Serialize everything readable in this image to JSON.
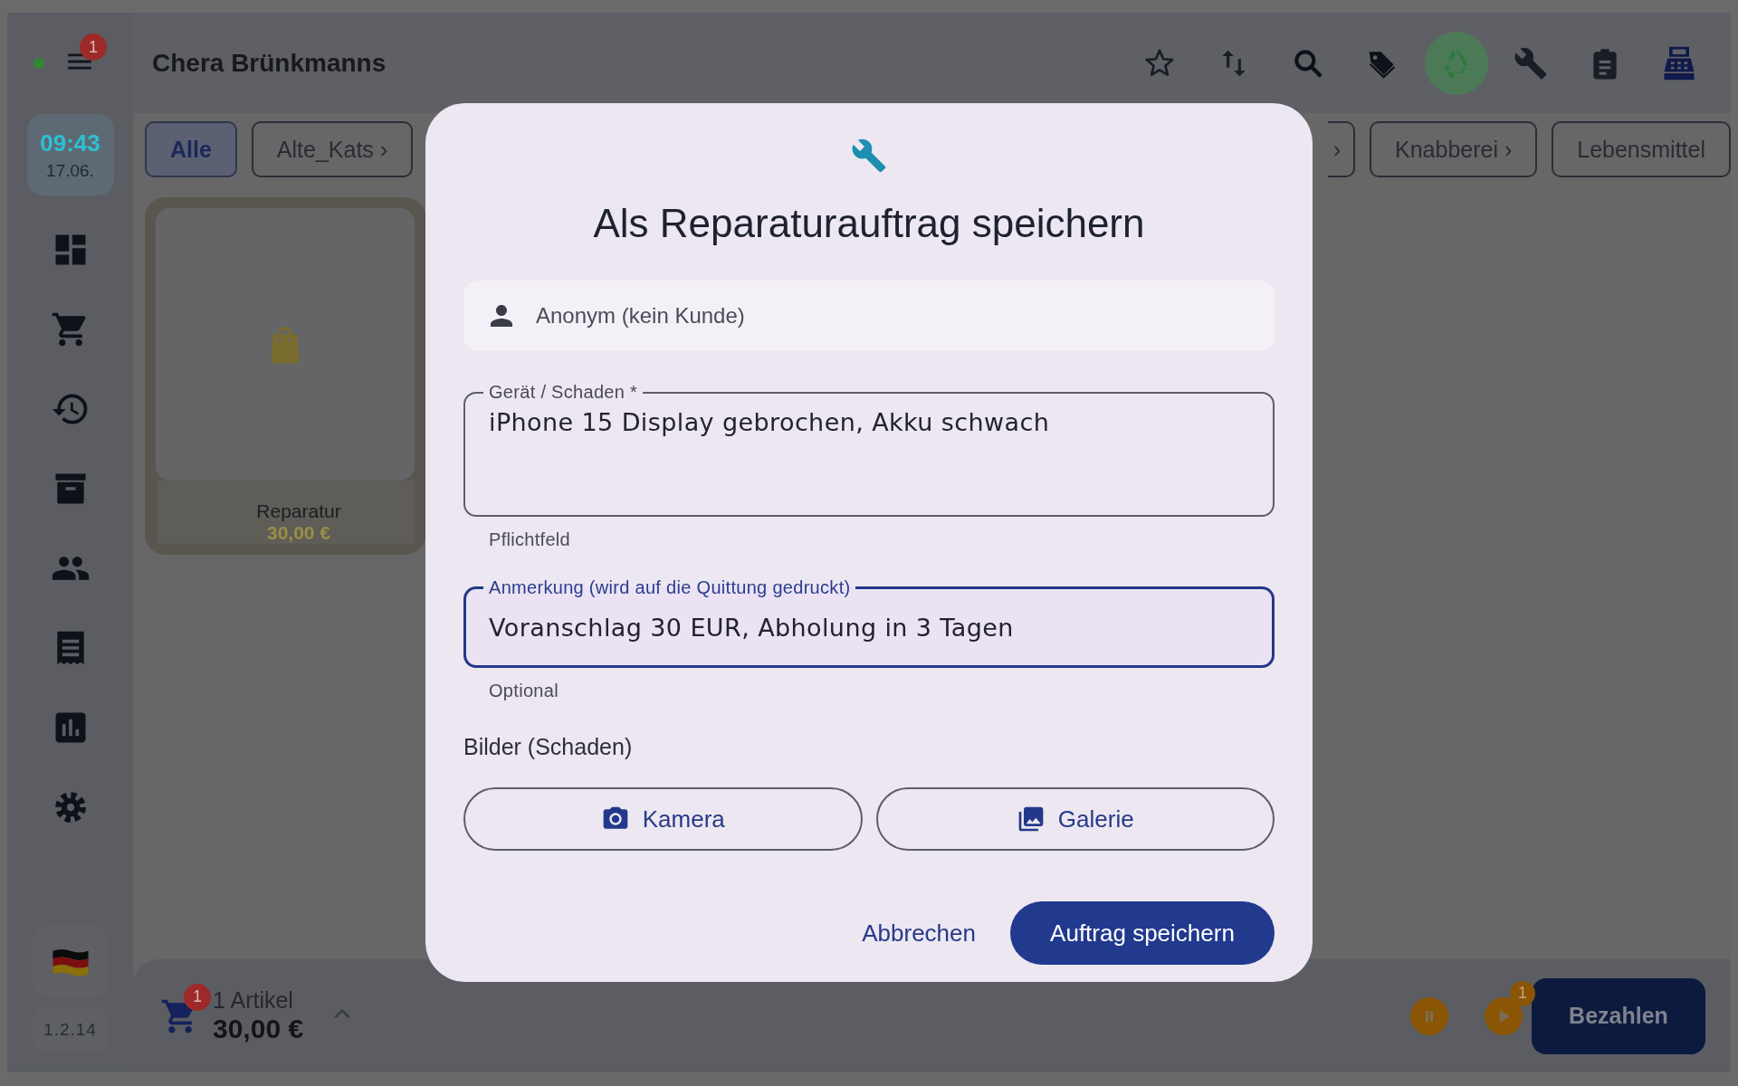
{
  "status": {
    "online": true
  },
  "menu": {
    "badge": "1"
  },
  "clock": {
    "time": "09:43",
    "date": "17.06."
  },
  "version": "1.2.14",
  "header": {
    "title": "Chera Brünkmanns"
  },
  "toolbar": [
    {
      "selected": false
    },
    {
      "selected": false
    },
    {
      "selected": false
    },
    {
      "selected": false
    },
    {
      "selected": true
    },
    {
      "selected": false
    },
    {
      "selected": false
    },
    {
      "selected": false
    }
  ],
  "chips": [
    {
      "label": "Alle",
      "selected": true
    },
    {
      "label": "Alte_Kats ›",
      "selected": false
    },
    {
      "label": "›",
      "selected": false
    },
    {
      "label": "Knabberei ›",
      "selected": false
    },
    {
      "label": "Lebensmittel",
      "selected": false
    }
  ],
  "products": [
    {
      "name": "Reparatur",
      "price": "30,00 €"
    }
  ],
  "cart": {
    "badge": "1",
    "count": "1 Artikel",
    "total": "30,00 €"
  },
  "parked": {
    "badge": "1"
  },
  "pay_button": "Bezahlen",
  "dialog": {
    "title": "Als Reparaturauftrag speichern",
    "customer": "Anonym (kein Kunde)",
    "fields": [
      {
        "label": "Gerät / Schaden *",
        "value": "iPhone 15 Display gebrochen, Akku schwach",
        "helper": "Pflichtfeld",
        "focused": false
      },
      {
        "label": "Anmerkung (wird auf die Quittung gedruckt)",
        "value": "Voranschlag 30 EUR, Abholung in 3 Tagen",
        "helper": "Optional",
        "focused": true
      }
    ],
    "images_label": "Bilder (Schaden)",
    "image_buttons": [
      "Kamera",
      "Galerie"
    ],
    "cancel": "Abbrechen",
    "submit": "Auftrag speichern"
  }
}
